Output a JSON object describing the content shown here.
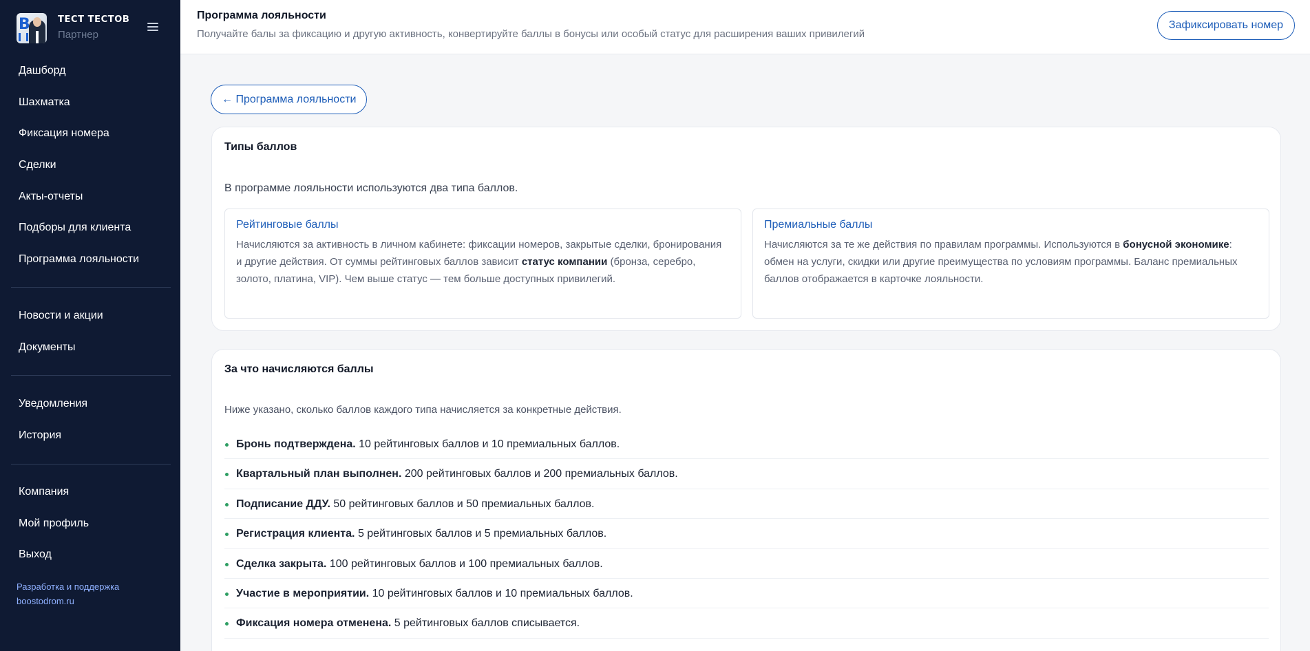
{
  "sidebar": {
    "user_name": "ТЕСТ ТЕСТОВ",
    "user_role": "Партнер",
    "nav_main": [
      {
        "label": "Дашборд"
      },
      {
        "label": "Шахматка"
      },
      {
        "label": "Фиксация номера"
      },
      {
        "label": "Сделки"
      },
      {
        "label": "Акты-отчеты"
      },
      {
        "label": "Подборы для клиента"
      },
      {
        "label": "Программа лояльности"
      }
    ],
    "nav_info": [
      {
        "label": "Новости и акции"
      },
      {
        "label": "Документы"
      }
    ],
    "nav_notify": [
      {
        "label": "Уведомления"
      },
      {
        "label": "История"
      }
    ],
    "nav_account": [
      {
        "label": "Компания"
      },
      {
        "label": "Мой профиль"
      },
      {
        "label": "Выход"
      }
    ],
    "credit_line1": "Разработка и поддержка",
    "credit_line2": "boostodrom.ru"
  },
  "header": {
    "title": "Программа лояльности",
    "subtitle": "Получайте балы за фиксацию и другую активность, конвертируйте баллы в бонусы или особый статус для расширения ваших привилегий",
    "action_label": "Зафиксировать номер"
  },
  "back_label": "← Программа лояльности",
  "point_types": {
    "title": "Типы баллов",
    "description": "В программе лояльности используются два типа баллов.",
    "rating": {
      "title": "Рейтинговые баллы",
      "text_1": "Начисляются за активность в личном кабинете: фиксации номеров, закрытые сделки, бронирования и другие действия. От суммы рейтинговых баллов зависит ",
      "text_bold": "статус компании",
      "text_2": " (бронза, серебро, золото, платина, VIP). Чем выше статус — тем больше доступных привилегий."
    },
    "premium": {
      "title": "Премиальные баллы",
      "text_1": "Начисляются за те же действия по правилам программы. Используются в ",
      "text_bold": "бонусной экономике",
      "text_2": ": обмен на услуги, скидки или другие преимущества по условиям программы. Баланс премиальных баллов отображается в карточке лояльности."
    }
  },
  "earning": {
    "title": "За что начисляются баллы",
    "description": "Ниже указано, сколько баллов каждого типа начисляется за конкретные действия.",
    "rules": [
      {
        "action": "Бронь подтверждена.",
        "points": "10 рейтинговых баллов и 10 премиальных баллов."
      },
      {
        "action": "Квартальный план выполнен.",
        "points": "200 рейтинговых баллов и 200 премиальных баллов."
      },
      {
        "action": "Подписание ДДУ.",
        "points": "50 рейтинговых баллов и 50 премиальных баллов."
      },
      {
        "action": "Регистрация клиента.",
        "points": "5 рейтинговых баллов и 5 премиальных баллов."
      },
      {
        "action": "Сделка закрыта.",
        "points": "100 рейтинговых баллов и 100 премиальных баллов."
      },
      {
        "action": "Участие в мероприятии.",
        "points": "10 рейтинговых баллов и 10 премиальных баллов."
      },
      {
        "action": "Фиксация номера отменена.",
        "points": "5 рейтинговых баллов списывается."
      }
    ]
  },
  "colors": {
    "sidebar_bg": "#0f1a33",
    "accent": "#1d5db8",
    "bullet": "#2e9e63"
  }
}
